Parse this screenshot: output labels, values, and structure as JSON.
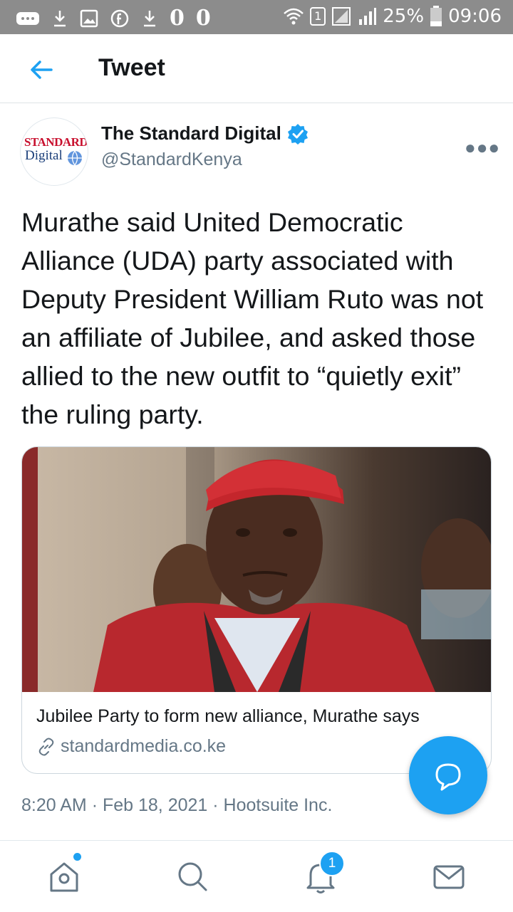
{
  "status_bar": {
    "icons": [
      "more-icon",
      "download-icon",
      "gallery-icon",
      "facebook-icon",
      "download-icon",
      "notification-icon"
    ],
    "o_marks": [
      "0",
      "0"
    ],
    "sim": "1",
    "battery": "25%",
    "time": "09:06"
  },
  "header": {
    "title": "Tweet"
  },
  "author": {
    "avatar_line1": "STANDARD",
    "avatar_line2": "Digital",
    "name": "The Standard Digital",
    "handle": "@StandardKenya",
    "verified": true
  },
  "tweet": {
    "text": "Murathe said United Democratic Alliance (UDA) party associated with Deputy President William Ruto was not an affiliate of Jubilee, and asked those allied to the new outfit to “quietly exit” the ruling party.",
    "time": "8:20 AM",
    "date": "Feb 18, 2021",
    "source": "Hootsuite Inc."
  },
  "card": {
    "title": "Jubilee Party to form new alliance, Murathe says",
    "domain": "standardmedia.co.ke"
  },
  "bottom_nav": {
    "items": [
      "home-icon",
      "search-icon",
      "notifications-icon",
      "messages-icon"
    ],
    "notifications_badge": "1"
  },
  "colors": {
    "accent": "#1da1f2",
    "text": "#14171a",
    "secondary": "#657786"
  }
}
